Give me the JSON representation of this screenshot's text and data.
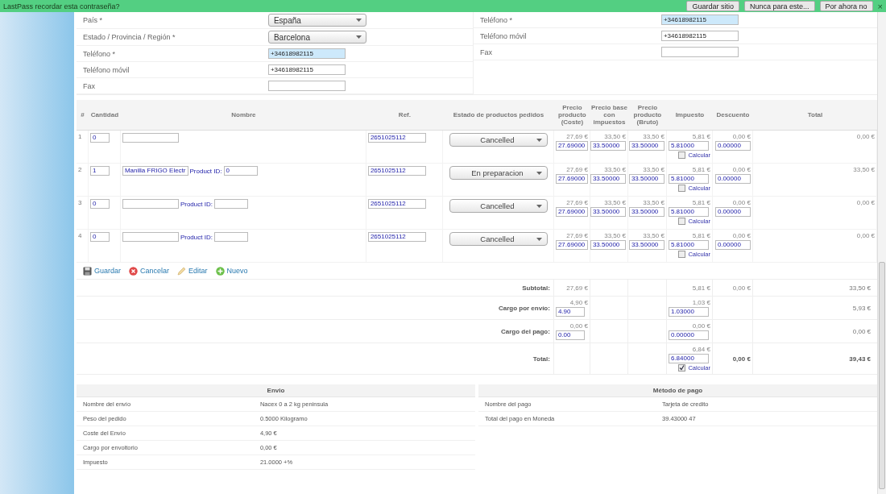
{
  "lastpass": {
    "prompt": "LastPass recordar esta contraseña?",
    "buttons": [
      "Guardar sitio",
      "Nunca para este...",
      "Por ahora no"
    ],
    "close": "×"
  },
  "address_left": [
    {
      "label": "País *",
      "kind": "select",
      "value": "España"
    },
    {
      "label": "Estado / Provincia / Región *",
      "kind": "select",
      "value": "Barcelona"
    },
    {
      "label": "Teléfono *",
      "kind": "input",
      "value": "+34618982115",
      "autofilled": true
    },
    {
      "label": "Teléfono móvil",
      "kind": "input",
      "value": "+34618982115",
      "autofilled": false
    },
    {
      "label": "Fax",
      "kind": "input",
      "autofilled": false
    }
  ],
  "address_right": [
    {
      "label": "Teléfono *",
      "kind": "input",
      "value": "+34618982115",
      "autofilled": true
    },
    {
      "label": "Teléfono móvil",
      "kind": "input",
      "value": "+34618982115",
      "autofilled": false
    },
    {
      "label": "Fax",
      "kind": "input",
      "autofilled": false
    }
  ],
  "items": {
    "columns": [
      "#",
      "Cantidad",
      "Nombre",
      "Ref.",
      "Estado de productos pedidos",
      "Precio producto (Coste)",
      "Precio base con impuestos",
      "Precio producto (Bruto)",
      "Impuesto",
      "Descuento",
      "Total"
    ],
    "rows": [
      {
        "index": "1",
        "quantity": "0",
        "ref": "2651025112",
        "status": "Cancelled",
        "cost_display": "27,69 €",
        "cost_value": "27.69000",
        "base_display": "33,50 €",
        "base_value": "33.50000",
        "gross_display": "33,50 €",
        "gross_value": "33.50000",
        "tax_display": "5,81 €",
        "tax_value": "5.81000",
        "calc_checked": false,
        "calc_label": "Calcular",
        "discount_display": "0,00 €",
        "discount_value": "0.00000",
        "total": "0,00 €"
      },
      {
        "index": "2",
        "quantity": "1",
        "name": "Manilla FRIGO Electr",
        "product_id_label": "Product ID:",
        "product_id": "0",
        "ref": "2651025112",
        "status": "En preparacion",
        "cost_display": "27,69 €",
        "cost_value": "27.69000",
        "base_display": "33,50 €",
        "base_value": "33.50000",
        "gross_display": "33,50 €",
        "gross_value": "33.50000",
        "tax_display": "5,81 €",
        "tax_value": "5.81000",
        "calc_checked": false,
        "calc_label": "Calcular",
        "discount_display": "0,00 €",
        "discount_value": "0.00000",
        "total": "33,50 €"
      },
      {
        "index": "3",
        "quantity": "0",
        "product_id_label": "Product ID:",
        "ref": "2651025112",
        "status": "Cancelled",
        "cost_display": "27,69 €",
        "cost_value": "27.69000",
        "base_display": "33,50 €",
        "base_value": "33.50000",
        "gross_display": "33,50 €",
        "gross_value": "33.50000",
        "tax_display": "5,81 €",
        "tax_value": "5.81000",
        "calc_checked": false,
        "calc_label": "Calcular",
        "discount_display": "0,00 €",
        "discount_value": "0.00000",
        "total": "0,00 €"
      },
      {
        "index": "4",
        "quantity": "0",
        "product_id_label": "Product ID:",
        "ref": "2651025112",
        "status": "Cancelled",
        "cost_display": "27,69 €",
        "cost_value": "27.69000",
        "base_display": "33,50 €",
        "base_value": "33.50000",
        "gross_display": "33,50 €",
        "gross_value": "33.50000",
        "tax_display": "5,81 €",
        "tax_value": "5.81000",
        "calc_checked": false,
        "calc_label": "Calcular",
        "discount_display": "0,00 €",
        "discount_value": "0.00000",
        "total": "0,00 €"
      }
    ]
  },
  "actions": [
    {
      "kind": "save",
      "label": "Guardar"
    },
    {
      "kind": "cancel",
      "label": "Cancelar"
    },
    {
      "kind": "edit",
      "label": "Editar"
    },
    {
      "kind": "new",
      "label": "Nuevo"
    }
  ],
  "totals": [
    {
      "label": "Subtotal:",
      "cost_display": "27,69 €",
      "tax_display": "5,81 €",
      "discount": "0,00 €",
      "total": "33,50 €",
      "bold": false
    },
    {
      "label": "Cargo por envío:",
      "cost_display": "4,90 €",
      "cost_value": "4.90",
      "tax_display": "1,03 €",
      "tax_value": "1.03000",
      "total": "5,93 €",
      "bold": false
    },
    {
      "label": "Cargo del pago:",
      "cost_display": "0,00 €",
      "cost_value": "0.00",
      "tax_display": "0,00 €",
      "tax_value": "0.00000",
      "total": "0,00 €",
      "bold": false
    },
    {
      "label": "Total:",
      "tax_display": "6,84 €",
      "tax_value": "6.84000",
      "calc_checked": true,
      "calc_label": "Calcular",
      "discount": "0,00 €",
      "total": "39,43 €",
      "bold": true
    }
  ],
  "shipping": {
    "title": "Envio",
    "rows": [
      {
        "label": "Nombre del envío",
        "value": "Nacex 0 a 2 kg peninsula"
      },
      {
        "label": "Peso del pedido",
        "value": "0.5000 Kilogramo"
      },
      {
        "label": "Coste del Envío",
        "value": "4,90 €"
      },
      {
        "label": "Cargo por envoltorio",
        "value": "0,00 €"
      },
      {
        "label": "Impuesto",
        "value": "21.0000 +%"
      }
    ]
  },
  "payment": {
    "title": "Método de pago",
    "rows": [
      {
        "label": "Nombre del pago",
        "value": "Tarjeta de credito"
      },
      {
        "label": "Total del pago en Moneda",
        "value": "39.43000 47"
      }
    ]
  }
}
